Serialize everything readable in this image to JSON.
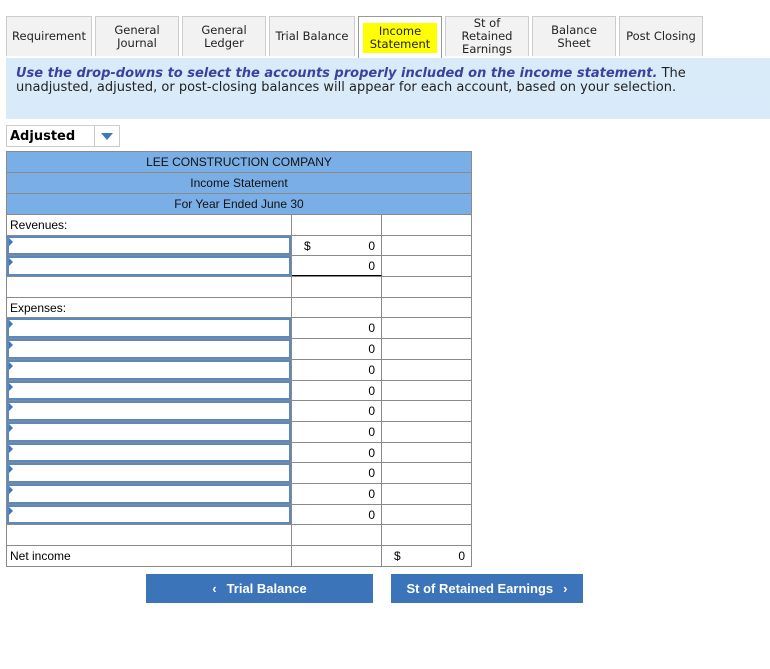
{
  "tabs": [
    {
      "label": "Requirement",
      "w": 86
    },
    {
      "label": "General Journal",
      "w": 84
    },
    {
      "label": "General Ledger",
      "w": 84
    },
    {
      "label": "Trial Balance",
      "w": 86
    },
    {
      "label": "Income Statement",
      "w": 84,
      "active": true
    },
    {
      "label": "St of Retained Earnings",
      "w": 84
    },
    {
      "label": "Balance Sheet",
      "w": 84
    },
    {
      "label": "Post Closing",
      "w": 84
    }
  ],
  "instructions": {
    "bold": "Use the drop-downs to select the accounts properly included on the income statement.",
    "rest": " The unadjusted, adjusted, or post-closing balances will appear for each account, based on your selection."
  },
  "balance_select": "Adjusted",
  "statement": {
    "company": "LEE CONSTRUCTION COMPANY",
    "title": "Income Statement",
    "period": "For Year Ended June 30",
    "revenues_label": "Revenues:",
    "expenses_label": "Expenses:",
    "net_income_label": "Net income",
    "revenue_rows": [
      {
        "cur": "$",
        "val": "0"
      },
      {
        "cur": "",
        "val": "0"
      }
    ],
    "expense_rows": [
      "0",
      "0",
      "0",
      "0",
      "0",
      "0",
      "0",
      "0",
      "0",
      "0"
    ],
    "net_income": {
      "cur": "$",
      "val": "0"
    }
  },
  "nav": {
    "prev": "Trial Balance",
    "next": "St of Retained Earnings"
  },
  "colors": {
    "accent": "#3b74b9",
    "header": "#7aaee6",
    "highlight": "#ffff00"
  }
}
